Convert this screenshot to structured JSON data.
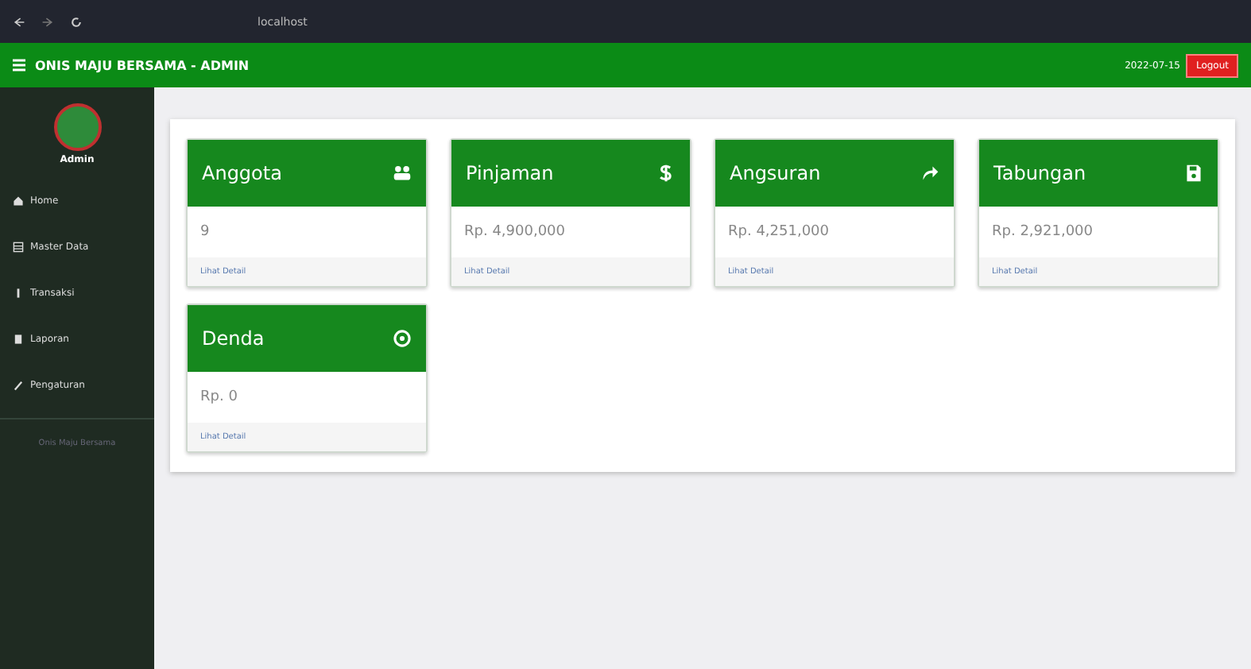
{
  "browser": {
    "url": "localhost"
  },
  "header": {
    "title": "ONIS MAJU BERSAMA - ADMIN",
    "date": "2022-07-15",
    "logout": "Logout"
  },
  "sidebar": {
    "user": "Admin",
    "items": [
      {
        "label": "Home"
      },
      {
        "label": "Master Data"
      },
      {
        "label": "Transaksi"
      },
      {
        "label": "Laporan"
      },
      {
        "label": "Pengaturan"
      }
    ],
    "footer": "Onis Maju Bersama"
  },
  "cards": [
    {
      "title": "Anggota",
      "value": "9",
      "link": "Lihat Detail"
    },
    {
      "title": "Pinjaman",
      "value": "Rp. 4,900,000",
      "link": "Lihat Detail"
    },
    {
      "title": "Angsuran",
      "value": "Rp. 4,251,000",
      "link": "Lihat Detail"
    },
    {
      "title": "Tabungan",
      "value": "Rp. 2,921,000",
      "link": "Lihat Detail"
    },
    {
      "title": "Denda",
      "value": "Rp. 0",
      "link": "Lihat Detail"
    }
  ]
}
